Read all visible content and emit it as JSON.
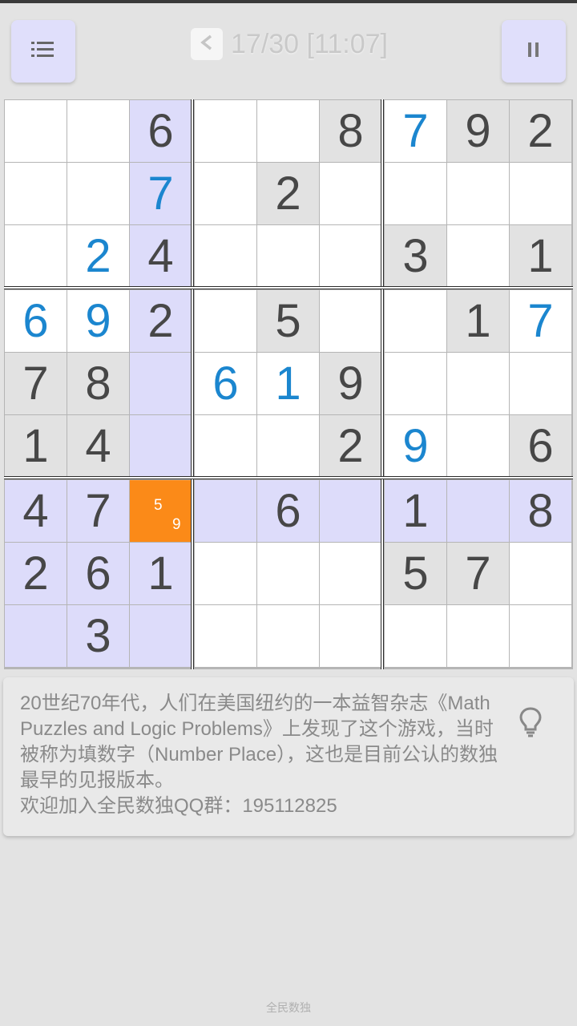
{
  "header": {
    "menu_icon": "list-icon",
    "back_icon": "chevron-left-icon",
    "progress": "17/30 [11:07]",
    "pause_icon": "pause-icon"
  },
  "colors": {
    "given": "#474747",
    "user": "#1b86cf",
    "selected": "#fb8a18",
    "highlight": "#dddcfa",
    "prefilled_bg": "#e2e2e2"
  },
  "board": {
    "rows": [
      [
        {
          "v": "",
          "t": "w"
        },
        {
          "v": "",
          "t": "w"
        },
        {
          "v": "6",
          "t": "h",
          "g": 1
        },
        {
          "v": "",
          "t": "w"
        },
        {
          "v": "",
          "t": "w"
        },
        {
          "v": "8",
          "t": "g",
          "g": 1
        },
        {
          "v": "7",
          "t": "w",
          "g": 0
        },
        {
          "v": "9",
          "t": "g",
          "g": 1
        },
        {
          "v": "2",
          "t": "g",
          "g": 1
        }
      ],
      [
        {
          "v": "",
          "t": "w"
        },
        {
          "v": "",
          "t": "w"
        },
        {
          "v": "7",
          "t": "h",
          "g": 0
        },
        {
          "v": "",
          "t": "w"
        },
        {
          "v": "2",
          "t": "g",
          "g": 1
        },
        {
          "v": "",
          "t": "w"
        },
        {
          "v": "",
          "t": "w"
        },
        {
          "v": "",
          "t": "w"
        },
        {
          "v": "",
          "t": "w"
        }
      ],
      [
        {
          "v": "",
          "t": "w"
        },
        {
          "v": "2",
          "t": "w",
          "g": 0
        },
        {
          "v": "4",
          "t": "h",
          "g": 1
        },
        {
          "v": "",
          "t": "w"
        },
        {
          "v": "",
          "t": "w"
        },
        {
          "v": "",
          "t": "w"
        },
        {
          "v": "3",
          "t": "g",
          "g": 1
        },
        {
          "v": "",
          "t": "w"
        },
        {
          "v": "1",
          "t": "g",
          "g": 1
        }
      ],
      [
        {
          "v": "6",
          "t": "w",
          "g": 0
        },
        {
          "v": "9",
          "t": "w",
          "g": 0
        },
        {
          "v": "2",
          "t": "h",
          "g": 1
        },
        {
          "v": "",
          "t": "w"
        },
        {
          "v": "5",
          "t": "g",
          "g": 1
        },
        {
          "v": "",
          "t": "w"
        },
        {
          "v": "",
          "t": "w"
        },
        {
          "v": "1",
          "t": "g",
          "g": 1
        },
        {
          "v": "7",
          "t": "w",
          "g": 0
        }
      ],
      [
        {
          "v": "7",
          "t": "g",
          "g": 1
        },
        {
          "v": "8",
          "t": "g",
          "g": 1
        },
        {
          "v": "",
          "t": "h"
        },
        {
          "v": "6",
          "t": "w",
          "g": 0
        },
        {
          "v": "1",
          "t": "w",
          "g": 0
        },
        {
          "v": "9",
          "t": "g",
          "g": 1
        },
        {
          "v": "",
          "t": "w"
        },
        {
          "v": "",
          "t": "w"
        },
        {
          "v": "",
          "t": "w"
        }
      ],
      [
        {
          "v": "1",
          "t": "g",
          "g": 1
        },
        {
          "v": "4",
          "t": "g",
          "g": 1
        },
        {
          "v": "",
          "t": "h"
        },
        {
          "v": "",
          "t": "w"
        },
        {
          "v": "",
          "t": "w"
        },
        {
          "v": "2",
          "t": "g",
          "g": 1
        },
        {
          "v": "9",
          "t": "w",
          "g": 0
        },
        {
          "v": "",
          "t": "w"
        },
        {
          "v": "6",
          "t": "g",
          "g": 1
        }
      ],
      [
        {
          "v": "4",
          "t": "h",
          "g": 1
        },
        {
          "v": "7",
          "t": "h",
          "g": 1
        },
        {
          "v": "",
          "t": "s",
          "notes": [
            "5",
            "9"
          ]
        },
        {
          "v": "",
          "t": "h"
        },
        {
          "v": "6",
          "t": "h",
          "g": 1
        },
        {
          "v": "",
          "t": "h"
        },
        {
          "v": "1",
          "t": "h",
          "g": 1
        },
        {
          "v": "",
          "t": "h"
        },
        {
          "v": "8",
          "t": "h",
          "g": 1
        }
      ],
      [
        {
          "v": "2",
          "t": "h",
          "g": 1
        },
        {
          "v": "6",
          "t": "h",
          "g": 1
        },
        {
          "v": "1",
          "t": "h",
          "g": 1
        },
        {
          "v": "",
          "t": "w"
        },
        {
          "v": "",
          "t": "w"
        },
        {
          "v": "",
          "t": "w"
        },
        {
          "v": "5",
          "t": "g",
          "g": 1
        },
        {
          "v": "7",
          "t": "g",
          "g": 1
        },
        {
          "v": "",
          "t": "w"
        }
      ],
      [
        {
          "v": "",
          "t": "h"
        },
        {
          "v": "3",
          "t": "h",
          "g": 1
        },
        {
          "v": "",
          "t": "h"
        },
        {
          "v": "",
          "t": "w"
        },
        {
          "v": "",
          "t": "w"
        },
        {
          "v": "",
          "t": "w"
        },
        {
          "v": "",
          "t": "w"
        },
        {
          "v": "",
          "t": "w"
        },
        {
          "v": "",
          "t": "w"
        }
      ]
    ]
  },
  "tip": {
    "text": "20世纪70年代，人们在美国纽约的一本益智杂志《Math Puzzles and Logic Problems》上发现了这个游戏，当时被称为填数字（Number Place），这也是目前公认的数独最早的见报版本。\n欢迎加入全民数独QQ群：195112825",
    "icon": "lightbulb-icon"
  },
  "footer": {
    "label": "全民数独"
  }
}
